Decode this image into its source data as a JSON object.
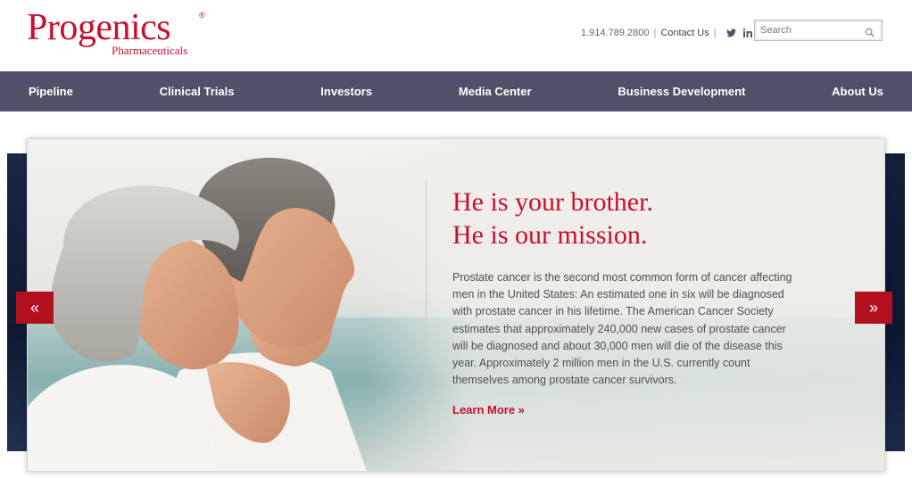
{
  "brand": {
    "name": "Progenics",
    "sub": "Pharmaceuticals",
    "reg": "®",
    "color": "#c8102e"
  },
  "utility": {
    "phone": "1.914.789.2800",
    "separator": "|",
    "contact": "Contact Us",
    "social": [
      "twitter-icon",
      "linkedin-icon"
    ]
  },
  "search": {
    "placeholder": "Search"
  },
  "nav": {
    "items": [
      {
        "label": "Pipeline"
      },
      {
        "label": "Clinical Trials"
      },
      {
        "label": "Investors"
      },
      {
        "label": "Media Center"
      },
      {
        "label": "Business Development"
      },
      {
        "label": "About Us"
      }
    ],
    "background": "#4e5168"
  },
  "hero": {
    "headline_line1": "He is your brother.",
    "headline_line2": "He is our mission.",
    "body": "Prostate cancer is the second most common form of cancer affecting men in the United States: An estimated one in six will be diagnosed with prostate cancer in his lifetime. The American Cancer Society estimates that approximately 240,000 new cases of prostate cancer will be diagnosed and about 30,000 men will die of the disease this year. Approximately 2 million men in the U.S. currently count themselves among prostate cancer survivors.",
    "cta": "Learn More »",
    "prev": "«",
    "next": "»"
  }
}
